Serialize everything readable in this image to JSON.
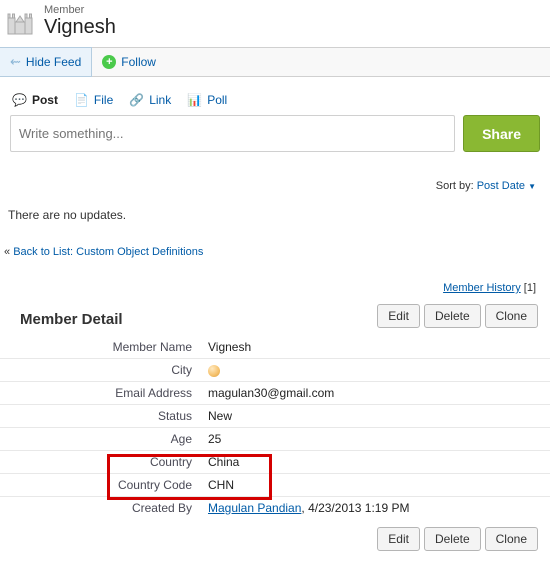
{
  "header": {
    "type": "Member",
    "name": "Vignesh"
  },
  "toolbar": {
    "hide": "Hide Feed",
    "follow": "Follow"
  },
  "tabs": {
    "post": "Post",
    "file": "File",
    "link": "Link",
    "poll": "Poll"
  },
  "compose": {
    "placeholder": "Write something...",
    "share": "Share"
  },
  "sort": {
    "label": "Sort by:",
    "value": "Post Date"
  },
  "feed": {
    "empty": "There are no updates."
  },
  "back": {
    "prefix": "« ",
    "label": "Back to List: Custom Object Definitions"
  },
  "history": {
    "label": "Member History",
    "count": "[1]"
  },
  "section": {
    "title": "Member Detail"
  },
  "buttons": {
    "edit": "Edit",
    "delete": "Delete",
    "clone": "Clone"
  },
  "fields": {
    "member_name": {
      "label": "Member Name",
      "value": "Vignesh"
    },
    "city": {
      "label": "City",
      "value": ""
    },
    "email": {
      "label": "Email Address",
      "value": "magulan30@gmail.com"
    },
    "status": {
      "label": "Status",
      "value": "New"
    },
    "age": {
      "label": "Age",
      "value": "25"
    },
    "country": {
      "label": "Country",
      "value": "China"
    },
    "country_code": {
      "label": "Country Code",
      "value": "CHN"
    },
    "created_by": {
      "label": "Created By",
      "name": "Magulan Pandian",
      "date": ", 4/23/2013 1:19 PM"
    }
  }
}
